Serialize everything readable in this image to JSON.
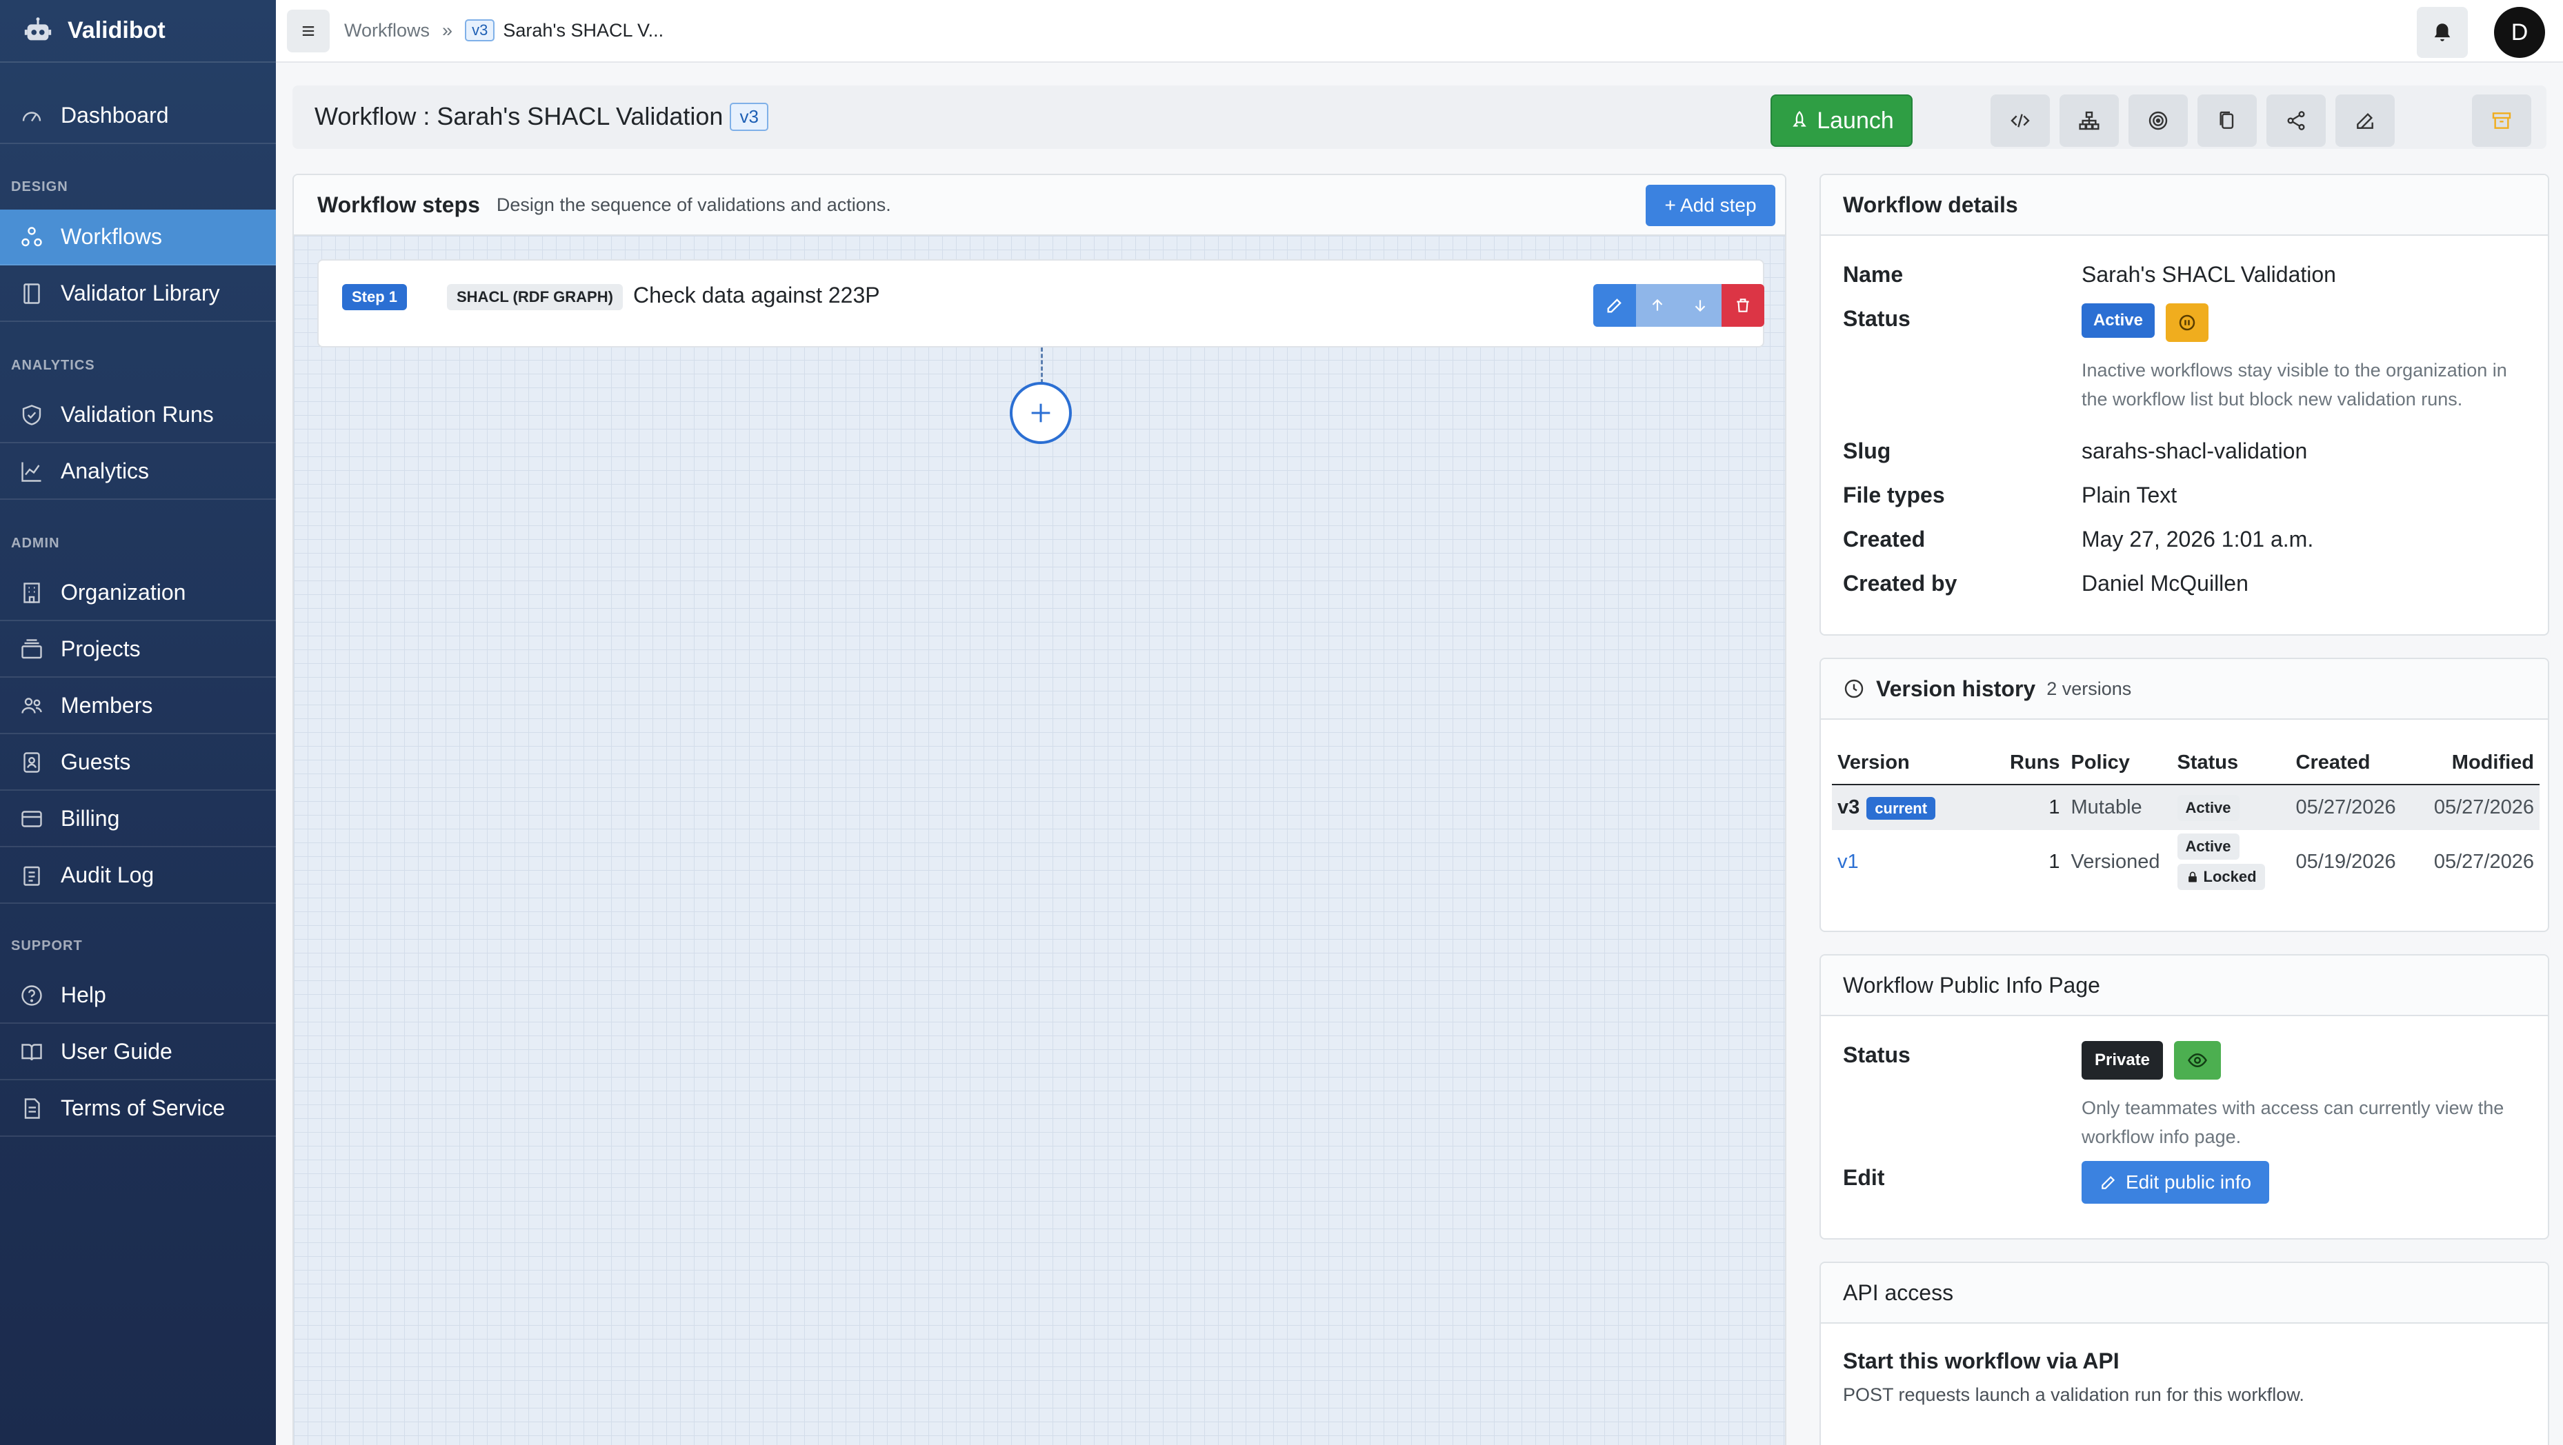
{
  "app": {
    "name": "Validibot"
  },
  "sidebar": {
    "dashboard": "Dashboard",
    "sections": {
      "design": "DESIGN",
      "analytics": "ANALYTICS",
      "admin": "ADMIN",
      "support": "SUPPORT"
    },
    "items": [
      {
        "label": "Workflows",
        "icon": "workflow-icon",
        "active": true
      },
      {
        "label": "Validator Library",
        "icon": "book-icon"
      },
      {
        "label": "Validation Runs",
        "icon": "shield-check-icon"
      },
      {
        "label": "Analytics",
        "icon": "chart-line-icon"
      },
      {
        "label": "Organization",
        "icon": "building-icon"
      },
      {
        "label": "Projects",
        "icon": "folder-stack-icon"
      },
      {
        "label": "Members",
        "icon": "users-icon"
      },
      {
        "label": "Guests",
        "icon": "id-badge-icon"
      },
      {
        "label": "Billing",
        "icon": "credit-card-icon"
      },
      {
        "label": "Audit Log",
        "icon": "clipboard-list-icon"
      },
      {
        "label": "Help",
        "icon": "question-circle-icon"
      },
      {
        "label": "User Guide",
        "icon": "open-book-icon"
      },
      {
        "label": "Terms of Service",
        "icon": "document-icon"
      }
    ]
  },
  "topbar": {
    "breadcrumb_root": "Workflows",
    "breadcrumb_sep": "»",
    "version_badge": "v3",
    "breadcrumb_current": "Sarah's SHACL V...",
    "avatar_initial": "D"
  },
  "titlebar": {
    "title": "Workflow : Sarah's SHACL Validation",
    "version": "v3",
    "launch_label": "Launch"
  },
  "steps": {
    "heading": "Workflow steps",
    "subheading": "Design the sequence of validations and actions.",
    "add_step_label": "+ Add step",
    "items": [
      {
        "badge": "Step 1",
        "type": "SHACL (RDF GRAPH)",
        "title": "Check data against 223P"
      }
    ]
  },
  "details": {
    "heading": "Workflow details",
    "name_label": "Name",
    "name_value": "Sarah's SHACL Validation",
    "status_label": "Status",
    "status_value": "Active",
    "status_help": "Inactive workflows stay visible to the organization in the workflow list but block new validation runs.",
    "slug_label": "Slug",
    "slug_value": "sarahs-shacl-validation",
    "filetypes_label": "File types",
    "filetypes_value": "Plain Text",
    "created_label": "Created",
    "created_value": "May 27, 2026 1:01 a.m.",
    "createdby_label": "Created by",
    "createdby_value": "Daniel McQuillen"
  },
  "versions": {
    "heading": "Version history",
    "count": "2 versions",
    "columns": [
      "Version",
      "Runs",
      "Policy",
      "Status",
      "Created",
      "Modified"
    ],
    "rows": [
      {
        "version": "v3",
        "tag": "current",
        "runs": "1",
        "policy": "Mutable",
        "status": "Active",
        "created": "05/27/2026",
        "modified": "05/27/2026"
      },
      {
        "version": "v1",
        "runs": "1",
        "policy": "Versioned",
        "status": "Active",
        "status2": "Locked",
        "created": "05/19/2026",
        "modified": "05/27/2026"
      }
    ]
  },
  "public_info": {
    "heading": "Workflow Public Info Page",
    "status_label": "Status",
    "status_value": "Private",
    "status_help": "Only teammates with access can currently view the workflow info page.",
    "edit_label": "Edit",
    "edit_button": "Edit public info"
  },
  "api": {
    "heading": "API access",
    "subheading": "Start this workflow via API",
    "description": "POST requests launch a validation run for this workflow."
  },
  "colors": {
    "sidebar": "#1f3358",
    "accent": "#3b82e0",
    "launch": "#2f9e44",
    "danger": "#dc3545",
    "warning": "#f0ad1e"
  }
}
